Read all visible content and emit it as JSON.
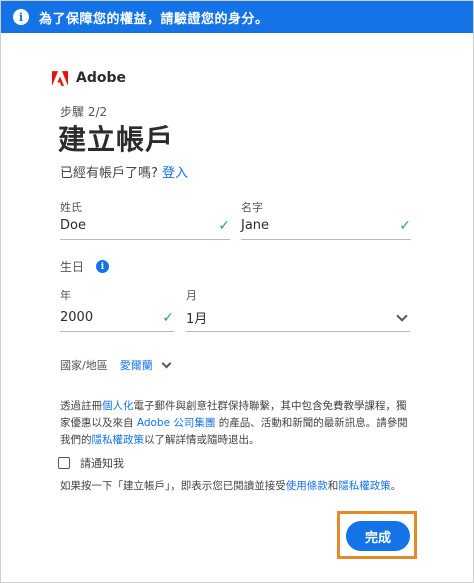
{
  "banner": {
    "text": "為了保障您的權益，請驗證您的身分。"
  },
  "brand": {
    "name": "Adobe",
    "color": "#eb1000"
  },
  "header": {
    "step": "步驟 2/2",
    "title": "建立帳戶",
    "have_account": "已經有帳戶了嗎?",
    "sign_in": "登入"
  },
  "form": {
    "last_name": {
      "label": "姓氏",
      "value": "Doe"
    },
    "first_name": {
      "label": "名字",
      "value": "Jane"
    },
    "birthday_label": "生日",
    "year": {
      "label": "年",
      "value": "2000"
    },
    "month": {
      "label": "月",
      "value": "1月"
    },
    "country": {
      "label": "國家/地區",
      "value": "愛爾蘭"
    }
  },
  "consent": {
    "t1": "透過註冊",
    "l1": "個人化",
    "t2": "電子郵件與創意社群保持聯繫，其中包含免費教學課程，獨家優惠以及來自 ",
    "l2": "Adobe 公司集團",
    "t3": " 的產品、活動和新聞的最新訊息。請參閱我們的",
    "l3": "隱私權政策",
    "t4": "以了解詳情或隨時退出。"
  },
  "notify_label": "請通知我",
  "terms": {
    "t1": "如果按一下「建立帳戶」，即表示您已閱讀並接受",
    "l1": "使用條款",
    "t2": "和",
    "l2": "隱私權政策",
    "t3": "。"
  },
  "done_button": "完成",
  "colors": {
    "accent": "#1473e6",
    "check": "#2d9d78",
    "highlight": "#e48a26"
  }
}
